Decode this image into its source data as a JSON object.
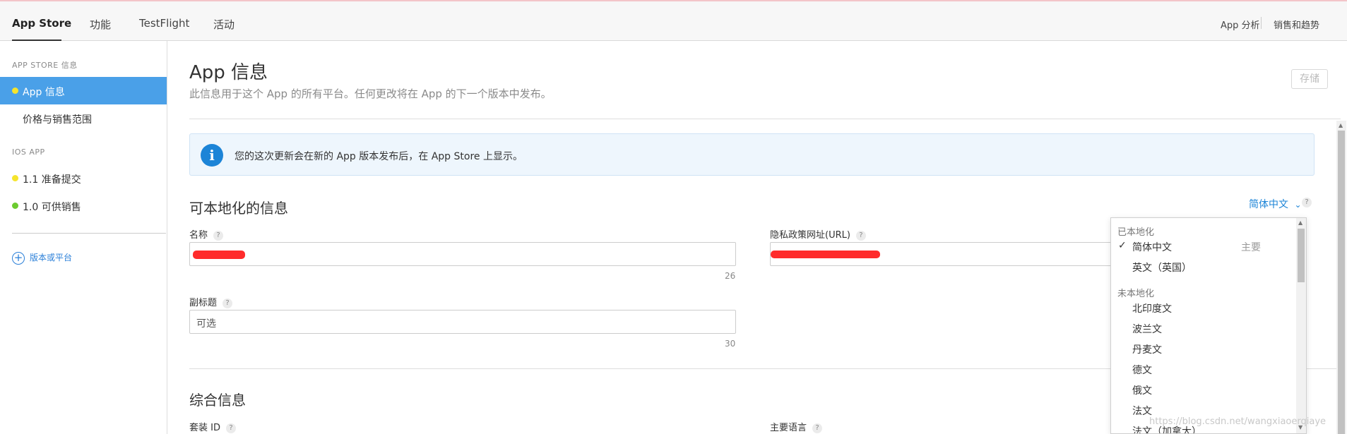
{
  "topnav": {
    "tabs": [
      {
        "label": "App Store",
        "active": true
      },
      {
        "label": "功能",
        "active": false
      },
      {
        "label": "TestFlight",
        "active": false
      },
      {
        "label": "活动",
        "active": false
      }
    ],
    "right_links": [
      "App 分析",
      "销售和趋势"
    ]
  },
  "sidebar": {
    "section_appstore": "APP STORE 信息",
    "items_appstore": [
      {
        "label": "App 信息",
        "active": true,
        "dot_color": "#f5e42c"
      },
      {
        "label": "价格与销售范围",
        "active": false
      }
    ],
    "section_ios": "IOS APP",
    "items_ios": [
      {
        "label": "1.1 准备提交",
        "dot_color": "#f5e42c"
      },
      {
        "label": "1.0 可供销售",
        "dot_color": "#6ccb2f"
      }
    ],
    "add_label": "版本或平台"
  },
  "main": {
    "title": "App 信息",
    "subtitle": "此信息用于这个 App 的所有平台。任何更改将在 App 的下一个版本中发布。",
    "save_label": "存储",
    "notice": "您的这次更新会在新的 App 版本发布后，在 App Store 上显示。",
    "localizable": {
      "title": "可本地化的信息",
      "language_selected": "简体中文",
      "fields": {
        "name_label": "名称",
        "name_count": "26",
        "privacy_label": "隐私政策网址(URL)",
        "subtitle_label": "副标题",
        "subtitle_placeholder": "可选",
        "subtitle_count": "30"
      }
    },
    "general": {
      "title": "综合信息",
      "bundle_label": "套装 ID",
      "primary_lang_label": "主要语言"
    }
  },
  "language_dropdown": {
    "localized_header": "已本地化",
    "localized": [
      {
        "label": "简体中文",
        "checked": true,
        "badge": "主要"
      },
      {
        "label": "英文（英国）",
        "checked": false,
        "badge": ""
      }
    ],
    "not_localized_header": "未本地化",
    "not_localized": [
      "北印度文",
      "波兰文",
      "丹麦文",
      "德文",
      "俄文",
      "法文",
      "法文（加拿大）"
    ]
  },
  "watermark": "https://blog.csdn.net/wangxiaoerqiaye"
}
